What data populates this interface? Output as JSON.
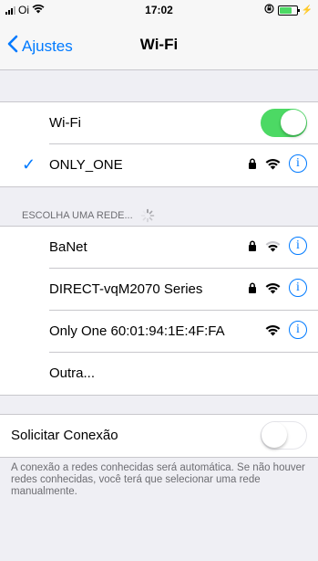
{
  "status": {
    "carrier": "Oi",
    "time": "17:02"
  },
  "nav": {
    "back_label": "Ajustes",
    "title": "Wi-Fi"
  },
  "wifi_toggle": {
    "label": "Wi-Fi",
    "state": "on"
  },
  "connected_network": {
    "name": "ONLY_ONE",
    "locked": true
  },
  "networks_header": "ESCOLHA UMA REDE...",
  "networks": [
    {
      "name": "BaNet",
      "locked": true
    },
    {
      "name": "DIRECT-vqM2070 Series",
      "locked": true
    },
    {
      "name": "Only One 60:01:94:1E:4F:FA",
      "locked": false
    },
    {
      "name": "Outra..."
    }
  ],
  "ask_to_join": {
    "label": "Solicitar Conexão",
    "state": "off"
  },
  "footer_text": "A conexão a redes conhecidas será automática. Se não houver redes conhecidas, você terá que selecionar uma rede manualmente.",
  "info_glyph": "i",
  "checkmark_glyph": "✓",
  "colors": {
    "accent": "#007aff",
    "toggle_on": "#4cd964",
    "background": "#efeff4"
  }
}
